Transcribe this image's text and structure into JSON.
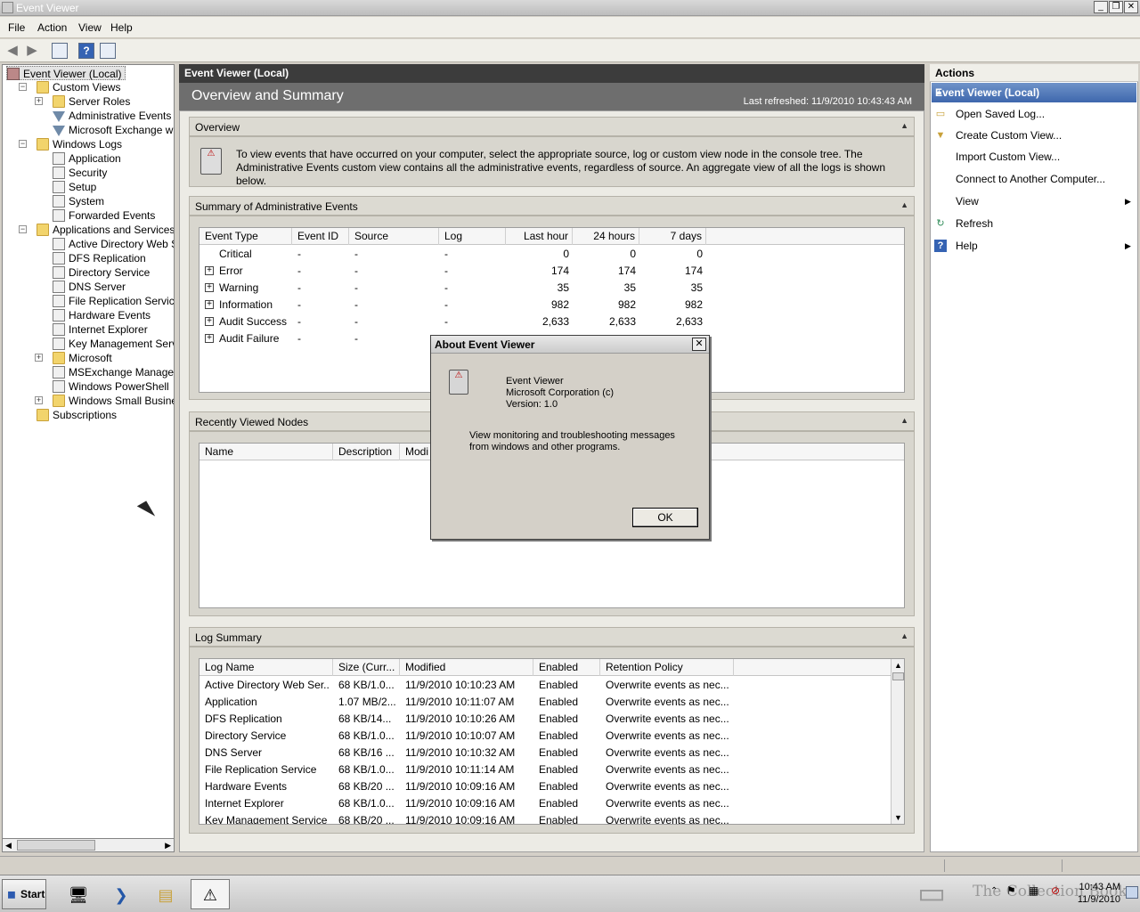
{
  "window": {
    "title": "Event Viewer"
  },
  "menu": [
    "File",
    "Action",
    "View",
    "Help"
  ],
  "tree": [
    {
      "label": "Event Viewer (Local)",
      "level": 0,
      "icon": "event-viewer-icon"
    },
    {
      "label": "Custom Views",
      "level": 1,
      "icon": "folder-icon",
      "expander": "−"
    },
    {
      "label": "Server Roles",
      "level": 2,
      "icon": "folder-icon",
      "expander": "+"
    },
    {
      "label": "Administrative Events",
      "level": 2,
      "icon": "filter-icon"
    },
    {
      "label": "Microsoft Exchange with Da",
      "level": 2,
      "icon": "filter-icon"
    },
    {
      "label": "Windows Logs",
      "level": 1,
      "icon": "folder-icon",
      "expander": "−"
    },
    {
      "label": "Application",
      "level": 2,
      "icon": "log-icon"
    },
    {
      "label": "Security",
      "level": 2,
      "icon": "log-icon"
    },
    {
      "label": "Setup",
      "level": 2,
      "icon": "log-icon"
    },
    {
      "label": "System",
      "level": 2,
      "icon": "log-icon"
    },
    {
      "label": "Forwarded Events",
      "level": 2,
      "icon": "log-icon"
    },
    {
      "label": "Applications and Services Logs",
      "level": 1,
      "icon": "folder-icon",
      "expander": "−"
    },
    {
      "label": "Active Directory Web Servic",
      "level": 2,
      "icon": "log-icon"
    },
    {
      "label": "DFS Replication",
      "level": 2,
      "icon": "log-icon"
    },
    {
      "label": "Directory Service",
      "level": 2,
      "icon": "log-icon"
    },
    {
      "label": "DNS Server",
      "level": 2,
      "icon": "log-icon"
    },
    {
      "label": "File Replication Service",
      "level": 2,
      "icon": "log-icon"
    },
    {
      "label": "Hardware Events",
      "level": 2,
      "icon": "log-icon"
    },
    {
      "label": "Internet Explorer",
      "level": 2,
      "icon": "log-icon"
    },
    {
      "label": "Key Management Service",
      "level": 2,
      "icon": "log-icon"
    },
    {
      "label": "Microsoft",
      "level": 2,
      "icon": "folder-icon",
      "expander": "+"
    },
    {
      "label": "MSExchange Management",
      "level": 2,
      "icon": "log-icon"
    },
    {
      "label": "Windows PowerShell",
      "level": 2,
      "icon": "log-icon"
    },
    {
      "label": "Windows Small Business Ser",
      "level": 2,
      "icon": "folder-icon",
      "expander": "+"
    },
    {
      "label": "Subscriptions",
      "level": 1,
      "icon": "subscriptions-icon"
    }
  ],
  "center": {
    "header": "Event Viewer (Local)",
    "subtitle": "Overview and Summary",
    "last_refreshed": "Last refreshed: 11/9/2010 10:43:43 AM",
    "overview": {
      "title": "Overview",
      "text_lines": [
        "To view events that have occurred on your computer, select the appropriate source, log or custom view node in the console tree. The",
        "Administrative Events custom view contains all the administrative events, regardless of source. An aggregate view of all the logs is shown",
        "below."
      ]
    },
    "summary": {
      "title": "Summary of Administrative Events",
      "columns": [
        "Event Type",
        "Event ID",
        "Source",
        "Log",
        "Last hour",
        "24 hours",
        "7 days"
      ],
      "rows": [
        {
          "type": "Critical",
          "id": "-",
          "source": "-",
          "log": "-",
          "hour": "0",
          "day": "0",
          "week": "0",
          "expandable": false
        },
        {
          "type": "Error",
          "id": "-",
          "source": "-",
          "log": "-",
          "hour": "174",
          "day": "174",
          "week": "174",
          "expandable": true
        },
        {
          "type": "Warning",
          "id": "-",
          "source": "-",
          "log": "-",
          "hour": "35",
          "day": "35",
          "week": "35",
          "expandable": true
        },
        {
          "type": "Information",
          "id": "-",
          "source": "-",
          "log": "-",
          "hour": "982",
          "day": "982",
          "week": "982",
          "expandable": true
        },
        {
          "type": "Audit Success",
          "id": "-",
          "source": "-",
          "log": "-",
          "hour": "2,633",
          "day": "2,633",
          "week": "2,633",
          "expandable": true
        },
        {
          "type": "Audit Failure",
          "id": "-",
          "source": "-",
          "log": "",
          "hour": "",
          "day": "",
          "week": "",
          "expandable": true
        }
      ]
    },
    "recent": {
      "title": "Recently Viewed Nodes",
      "columns": [
        "Name",
        "Description",
        "Modi"
      ]
    },
    "log_summary": {
      "title": "Log Summary",
      "columns": [
        "Log Name",
        "Size (Curr...",
        "Modified",
        "Enabled",
        "Retention Policy"
      ],
      "rows": [
        [
          "Active Directory Web Ser...",
          "68 KB/1.0...",
          "11/9/2010 10:10:23 AM",
          "Enabled",
          "Overwrite events as nec..."
        ],
        [
          "Application",
          "1.07 MB/2...",
          "11/9/2010 10:11:07 AM",
          "Enabled",
          "Overwrite events as nec..."
        ],
        [
          "DFS Replication",
          "68 KB/14...",
          "11/9/2010 10:10:26 AM",
          "Enabled",
          "Overwrite events as nec..."
        ],
        [
          "Directory Service",
          "68 KB/1.0...",
          "11/9/2010 10:10:07 AM",
          "Enabled",
          "Overwrite events as nec..."
        ],
        [
          "DNS Server",
          "68 KB/16 ...",
          "11/9/2010 10:10:32 AM",
          "Enabled",
          "Overwrite events as nec..."
        ],
        [
          "File Replication Service",
          "68 KB/1.0...",
          "11/9/2010 10:11:14 AM",
          "Enabled",
          "Overwrite events as nec..."
        ],
        [
          "Hardware Events",
          "68 KB/20 ...",
          "11/9/2010 10:09:16 AM",
          "Enabled",
          "Overwrite events as nec..."
        ],
        [
          "Internet Explorer",
          "68 KB/1.0...",
          "11/9/2010 10:09:16 AM",
          "Enabled",
          "Overwrite events as nec..."
        ],
        [
          "Key Management Service",
          "68 KB/20 ...",
          "11/9/2010 10:09:16 AM",
          "Enabled",
          "Overwrite events as nec..."
        ]
      ]
    }
  },
  "actions": {
    "title": "Actions",
    "section": "Event Viewer (Local)",
    "items": [
      {
        "label": "Open Saved Log...",
        "icon": "open-folder-icon",
        "submenu": false
      },
      {
        "label": "Create Custom View...",
        "icon": "filter-icon",
        "submenu": false
      },
      {
        "label": "Import Custom View...",
        "icon": "",
        "submenu": false
      },
      {
        "label": "Connect to Another Computer...",
        "icon": "",
        "submenu": false
      },
      {
        "label": "View",
        "icon": "",
        "submenu": true
      },
      {
        "label": "Refresh",
        "icon": "refresh-icon",
        "submenu": false
      },
      {
        "label": "Help",
        "icon": "help-icon",
        "submenu": true
      }
    ]
  },
  "dialog": {
    "title": "About Event Viewer",
    "app_name": "Event Viewer",
    "company": "Microsoft Corporation (c)",
    "version": "Version: 1.0",
    "desc_line1": "View monitoring and troubleshooting messages",
    "desc_line2": "from windows and other programs.",
    "ok_label": "OK"
  },
  "taskbar": {
    "start_label": "Start",
    "watermark": "The Collection Book",
    "time": "10:43 AM",
    "date": "11/9/2010"
  }
}
